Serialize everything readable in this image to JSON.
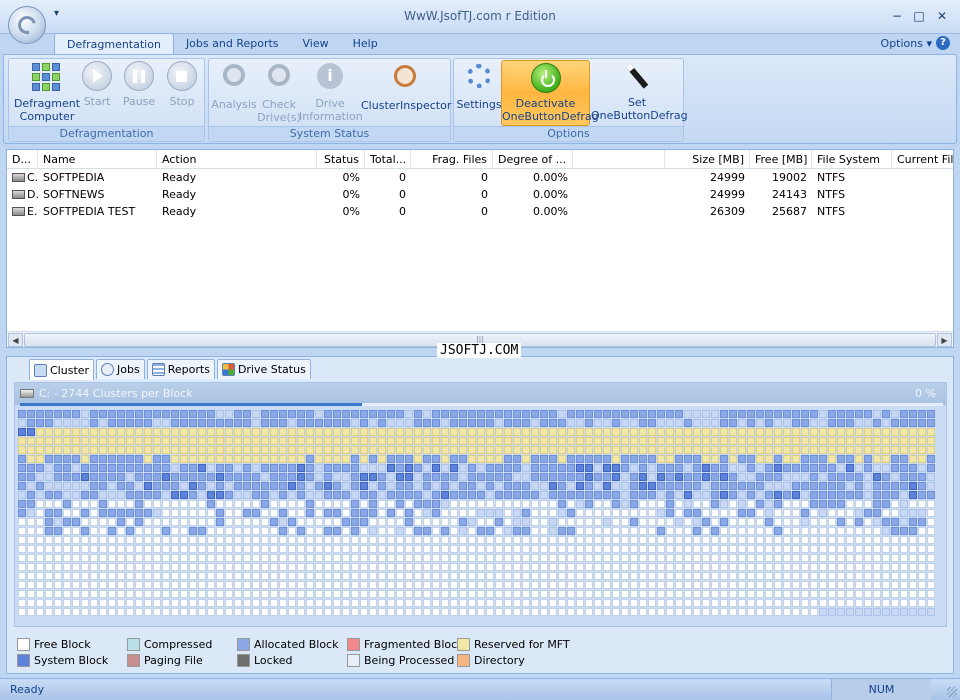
{
  "window": {
    "title": "WwW.JsofTJ.com r Edition",
    "qat_label": "▾",
    "minimize": "−",
    "maximize": "□",
    "close": "✕"
  },
  "ribbon_tabs": [
    "Defragmentation",
    "Jobs and Reports",
    "View",
    "Help"
  ],
  "options_menu": "Options ▾",
  "help_glyph": "?",
  "ribbon": {
    "defrag_group": {
      "label": "Defragmentation",
      "defragment_computer": "Defragment Computer",
      "start": "Start",
      "pause": "Pause",
      "stop": "Stop"
    },
    "status_group": {
      "label": "System Status",
      "analysis": "Analysis",
      "check_drives": "Check Drive(s)",
      "drive_information": "Drive Information",
      "cluster_inspector": "ClusterInspector"
    },
    "options_group": {
      "label": "Options",
      "settings": "Settings",
      "deactivate": "Deactivate OneButtonDefrag",
      "set_onebutton": "Set OneButtonDefrag"
    }
  },
  "drive_table": {
    "columns": [
      "D...",
      "Name",
      "Action",
      "Status",
      "Total...",
      "Frag. Files",
      "Degree of ...",
      "",
      "Size [MB]",
      "Free [MB]",
      "File System",
      "Current File"
    ],
    "rows": [
      {
        "drive": "C.",
        "name": "SOFTPEDIA",
        "action": "Ready",
        "status": "0%",
        "total": "0",
        "frag_files": "0",
        "degree": "0.00%",
        "size": "24999",
        "free": "19002",
        "fs": "NTFS"
      },
      {
        "drive": "D.",
        "name": "SOFTNEWS",
        "action": "Ready",
        "status": "0%",
        "total": "0",
        "frag_files": "0",
        "degree": "0.00%",
        "size": "24999",
        "free": "24143",
        "fs": "NTFS"
      },
      {
        "drive": "E.",
        "name": "SOFTPEDIA TEST",
        "action": "Ready",
        "status": "0%",
        "total": "0",
        "frag_files": "0",
        "degree": "0.00%",
        "size": "26309",
        "free": "25687",
        "fs": "NTFS"
      }
    ]
  },
  "scrollbar": {
    "left": "◀",
    "right": "▶",
    "grip": "|||"
  },
  "watermark": "JSOFTJ.COM",
  "bottom_tabs": [
    "Cluster",
    "Jobs",
    "Reports",
    "Drive Status"
  ],
  "cluster_view": {
    "title": "C: - 2744 Clusters per Block",
    "percent": "0 %",
    "progress_fraction": 0.37
  },
  "legend": [
    {
      "label": "Free Block",
      "color": "#ffffff"
    },
    {
      "label": "Compressed",
      "color": "#b8e0e6"
    },
    {
      "label": "Allocated Block",
      "color": "#8aa8e8"
    },
    {
      "label": "Fragmented Block",
      "color": "#f08a8a"
    },
    {
      "label": "Reserved for MFT",
      "color": "#f2e7a6"
    },
    {
      "label": "System Block",
      "color": "#5c82dc"
    },
    {
      "label": "Paging File",
      "color": "#c98f8f"
    },
    {
      "label": "Locked",
      "color": "#6e6e6e"
    },
    {
      "label": "Being Processed",
      "color": "#e8eef8"
    },
    {
      "label": "Directory",
      "color": "#f5b680"
    }
  ],
  "statusbar": {
    "text": "Ready",
    "num": "NUM"
  }
}
